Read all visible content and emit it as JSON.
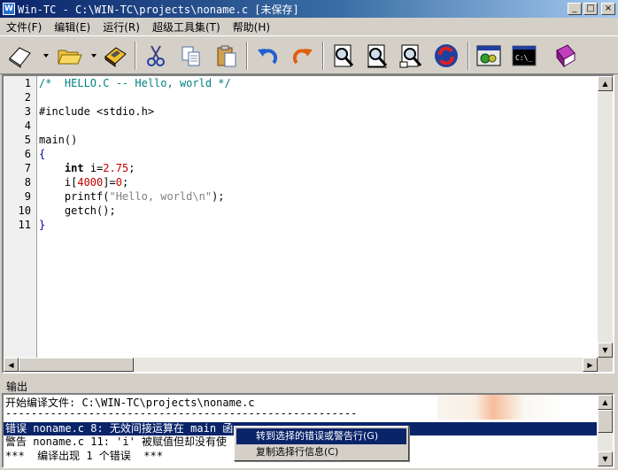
{
  "window": {
    "title": "Win-TC - C:\\WIN-TC\\projects\\noname.c [未保存]",
    "icon_label": "W",
    "buttons": {
      "minimize": "_",
      "maximize": "□",
      "close": "×"
    }
  },
  "menu": [
    "文件(F)",
    "编辑(E)",
    "运行(R)",
    "超级工具集(T)",
    "帮助(H)"
  ],
  "toolbar": [
    {
      "name": "new-file-icon"
    },
    {
      "name": "open-folder-icon"
    },
    {
      "name": "save-disk-icon"
    },
    {
      "name": "cut-scissors-icon"
    },
    {
      "name": "copy-icon"
    },
    {
      "name": "paste-icon"
    },
    {
      "name": "undo-icon"
    },
    {
      "name": "redo-icon"
    },
    {
      "name": "find-icon"
    },
    {
      "name": "find-next-icon"
    },
    {
      "name": "replace-icon"
    },
    {
      "name": "refresh-icon"
    },
    {
      "name": "compile-run-icon"
    },
    {
      "name": "console-icon"
    },
    {
      "name": "help-book-icon"
    }
  ],
  "editor": {
    "line_numbers": [
      "1",
      "2",
      "3",
      "4",
      "5",
      "6",
      "7",
      "8",
      "9",
      "10",
      "11"
    ],
    "lines": [
      {
        "parts": [
          {
            "t": "/*  HELLO.C -- Hello, world */",
            "c": "comment"
          }
        ]
      },
      {
        "parts": []
      },
      {
        "parts": [
          {
            "t": "#include <stdio.h>",
            "c": "plain"
          }
        ]
      },
      {
        "parts": []
      },
      {
        "parts": [
          {
            "t": "main()",
            "c": "plain"
          }
        ]
      },
      {
        "parts": [
          {
            "t": "{",
            "c": "brace"
          }
        ]
      },
      {
        "parts": [
          {
            "t": "    ",
            "c": "plain"
          },
          {
            "t": "int",
            "c": "kw"
          },
          {
            "t": " i=",
            "c": "plain"
          },
          {
            "t": "2.75",
            "c": "num"
          },
          {
            "t": ";",
            "c": "plain"
          }
        ]
      },
      {
        "parts": [
          {
            "t": "    i[",
            "c": "plain"
          },
          {
            "t": "4000",
            "c": "num"
          },
          {
            "t": "]=",
            "c": "plain"
          },
          {
            "t": "0",
            "c": "num"
          },
          {
            "t": ";",
            "c": "plain"
          }
        ]
      },
      {
        "parts": [
          {
            "t": "    printf(",
            "c": "plain"
          },
          {
            "t": "\"Hello, world\\n\"",
            "c": "str"
          },
          {
            "t": ");",
            "c": "plain"
          }
        ]
      },
      {
        "parts": [
          {
            "t": "    getch();",
            "c": "plain"
          }
        ]
      },
      {
        "parts": [
          {
            "t": "}",
            "c": "brace"
          }
        ]
      }
    ]
  },
  "output": {
    "label": "输出",
    "lines": [
      "开始编译文件: C:\\WIN-TC\\projects\\noname.c",
      "-------------------------------------------------------",
      "错误 noname.c 8: 无效间接运算在 main 函",
      "警告 noname.c 11: 'i' 被赋值但却没有使",
      "***  编译出现 1 个错误  ***"
    ],
    "selected_index": 2
  },
  "context_menu": {
    "items": [
      "转到选择的错误或警告行(G)",
      "复制选择行信息(C)"
    ],
    "highlighted_index": 0
  },
  "colors": {
    "title_start": "#0a246a",
    "title_end": "#a6caf0",
    "comment": "#008080",
    "number": "#c00000",
    "string": "#808080",
    "selection": "#0a246a"
  }
}
